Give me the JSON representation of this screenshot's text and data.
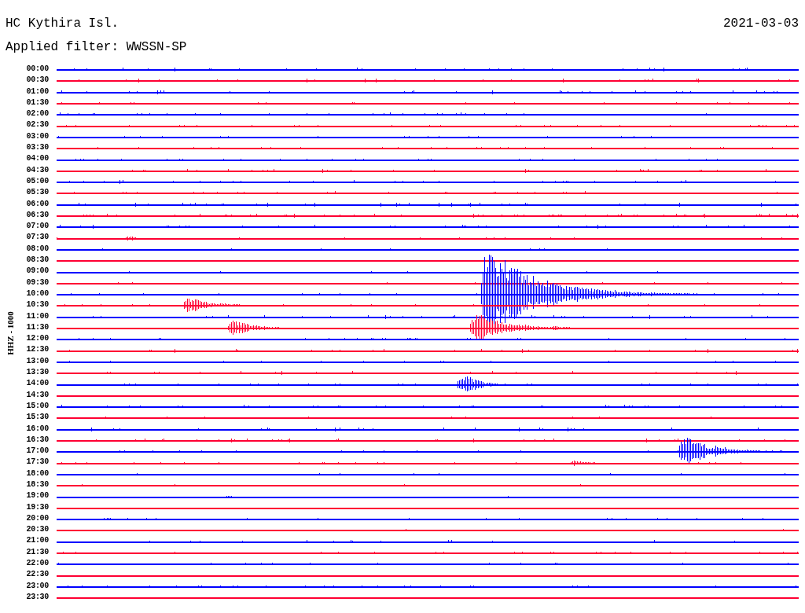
{
  "station": "HC Kythira Isl.",
  "date": "2021-03-03",
  "filter": "Applied filter: WWSSN-SP",
  "channel_label": "HHZ - 1000",
  "rows": [
    {
      "time": "00:00",
      "color": "#0000ff"
    },
    {
      "time": "00:30",
      "color": "#ff0033"
    },
    {
      "time": "01:00",
      "color": "#0000ff"
    },
    {
      "time": "01:30",
      "color": "#ff0033"
    },
    {
      "time": "02:00",
      "color": "#0000ff"
    },
    {
      "time": "02:30",
      "color": "#ff0033"
    },
    {
      "time": "03:00",
      "color": "#0000ff"
    },
    {
      "time": "03:30",
      "color": "#ff0033"
    },
    {
      "time": "04:00",
      "color": "#0000ff"
    },
    {
      "time": "04:30",
      "color": "#ff0033"
    },
    {
      "time": "05:00",
      "color": "#0000ff"
    },
    {
      "time": "05:30",
      "color": "#ff0033"
    },
    {
      "time": "06:00",
      "color": "#0000ff"
    },
    {
      "time": "06:30",
      "color": "#ff0033"
    },
    {
      "time": "07:00",
      "color": "#0000ff"
    },
    {
      "time": "07:30",
      "color": "#ff0033"
    },
    {
      "time": "08:00",
      "color": "#0000ff"
    },
    {
      "time": "08:30",
      "color": "#ff0033"
    },
    {
      "time": "09:00",
      "color": "#0000ff"
    },
    {
      "time": "09:30",
      "color": "#ff0033"
    },
    {
      "time": "10:00",
      "color": "#0000ff"
    },
    {
      "time": "10:30",
      "color": "#ff0033"
    },
    {
      "time": "11:00",
      "color": "#0000ff"
    },
    {
      "time": "11:30",
      "color": "#ff0033"
    },
    {
      "time": "12:00",
      "color": "#0000ff"
    },
    {
      "time": "12:30",
      "color": "#ff0033"
    },
    {
      "time": "13:00",
      "color": "#0000ff"
    },
    {
      "time": "13:30",
      "color": "#ff0033"
    },
    {
      "time": "14:00",
      "color": "#0000ff"
    },
    {
      "time": "14:30",
      "color": "#ff0033"
    },
    {
      "time": "15:00",
      "color": "#0000ff"
    },
    {
      "time": "15:30",
      "color": "#ff0033"
    },
    {
      "time": "16:00",
      "color": "#0000ff"
    },
    {
      "time": "16:30",
      "color": "#ff0033"
    },
    {
      "time": "17:00",
      "color": "#0000ff"
    },
    {
      "time": "17:30",
      "color": "#ff0033"
    },
    {
      "time": "18:00",
      "color": "#0000ff"
    },
    {
      "time": "18:30",
      "color": "#ff0033"
    },
    {
      "time": "19:00",
      "color": "#0000ff"
    },
    {
      "time": "19:30",
      "color": "#ff0033"
    },
    {
      "time": "20:00",
      "color": "#0000ff"
    },
    {
      "time": "20:30",
      "color": "#ff0033"
    },
    {
      "time": "21:00",
      "color": "#0000ff"
    },
    {
      "time": "21:30",
      "color": "#ff0033"
    },
    {
      "time": "22:00",
      "color": "#0000ff"
    },
    {
      "time": "22:30",
      "color": "#ff0033"
    },
    {
      "time": "23:00",
      "color": "#0000ff"
    },
    {
      "time": "23:30",
      "color": "#ff0033"
    }
  ]
}
